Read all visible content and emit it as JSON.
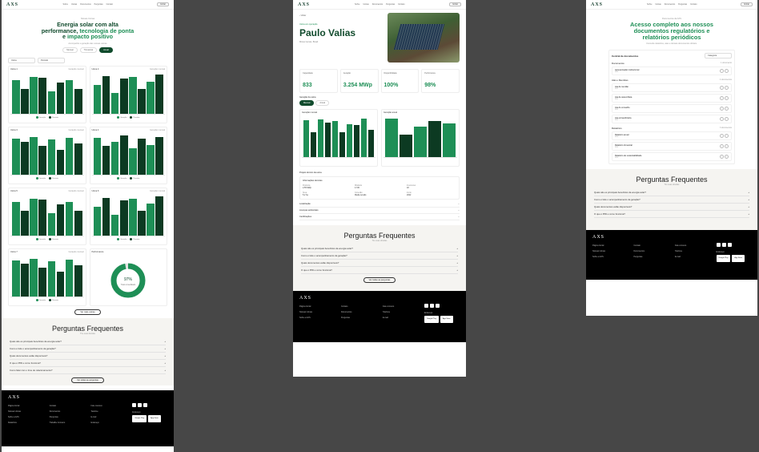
{
  "nav": {
    "logo": "AXS",
    "links": [
      "Sobre",
      "Usinas",
      "Documentos",
      "Perguntas",
      "Contato"
    ],
    "button": "Entrar"
  },
  "page1": {
    "kicker": "Nossas Usinas",
    "title_line1": "Energia solar com alta",
    "title_line2a": "performance, ",
    "title_line2b": "tecnologia de ponta",
    "title_line3a": "e ",
    "title_line3b": "impacto positivo",
    "subtitle": "Acompanhe a geração das nossas usinas",
    "pills": [
      "Mensal",
      "Trimestral",
      "Anual"
    ],
    "select_a": "Usina",
    "select_b": "Período",
    "cards": [
      {
        "name": "Usina 1",
        "info": "Geração mensal"
      },
      {
        "name": "Usina 2",
        "info": "Geração mensal"
      },
      {
        "name": "Usina 3",
        "info": "Geração mensal"
      },
      {
        "name": "Usina 4",
        "info": "Geração mensal"
      },
      {
        "name": "Usina 5",
        "info": "Geração mensal"
      },
      {
        "name": "Usina 6",
        "info": "Geração mensal"
      },
      {
        "name": "Usina 7",
        "info": "Geração mensal"
      }
    ],
    "legend": [
      "Geração",
      "Prevista"
    ],
    "donut": {
      "title": "Performance",
      "value": "97%",
      "label": "Total consolidado",
      "level": 0.97
    },
    "more_button": "Ver mais usinas"
  },
  "faq": {
    "title": "Perguntas Frequentes",
    "subtitle": "Tire suas dúvidas",
    "items": [
      "Quais são os principais benefícios da energia solar?",
      "Como é feito o acompanhamento da geração?",
      "Quais documentos estão disponíveis?",
      "O que é PPA e como funciona?",
      "Como falar com o time de relacionamento?"
    ],
    "button": "Ver todas as perguntas"
  },
  "footer": {
    "logo": "AXS",
    "cols": [
      [
        "Página Inicial",
        "Nossas Usinas",
        "Sobre a AXS",
        "Relatórios"
      ],
      [
        "Contato",
        "Documentos",
        "Perguntas",
        "Trabalhe Conosco"
      ],
      [
        "Fale conosco",
        "Telefone",
        "E-mail",
        "Endereço"
      ]
    ],
    "address_title": "Endereço",
    "stores": [
      "Google Play",
      "App Store"
    ]
  },
  "page2": {
    "back": "Voltar",
    "tag": "Usina em operação",
    "name": "Paulo Valias",
    "location": "Minas Gerais, Brasil",
    "stats": [
      {
        "label": "Capacidade",
        "value": "833"
      },
      {
        "label": "Geração",
        "value": "3.254 MWp"
      },
      {
        "label": "Disponibilidade",
        "value": "100%"
      },
      {
        "label": "Performance",
        "value": "98%"
      }
    ],
    "section": "Geração da usina",
    "tabs": [
      "Mensal",
      "Anual"
    ],
    "chart_a": "Geração mensal",
    "chart_b": "Geração anual",
    "details_title": "Projeto técnico da usina",
    "info_title": "Informações técnicas",
    "info": [
      {
        "k": "Potência",
        "v": "2,55 MWp"
      },
      {
        "k": "Módulos",
        "v": "4.720"
      },
      {
        "k": "Inversores",
        "v": "18"
      },
      {
        "k": "Área",
        "v": "5,2 ha"
      },
      {
        "k": "Conexão",
        "v": "Média tensão"
      },
      {
        "k": "Início",
        "v": "2022"
      }
    ],
    "accordions": [
      "Localização",
      "Licenças ambientais",
      "Certificações"
    ]
  },
  "page3": {
    "kicker": "Documentos da AXS",
    "title_a": "Acesso completo aos nossos",
    "title_b": "documentos regulatórios e",
    "title_c": "relatórios periódicos",
    "intro": "Consulte relatórios, atas e demais documentos oficiais.",
    "panel_title": "Central de documentos",
    "select": "Categoria",
    "sections": [
      {
        "title": "Documentos",
        "count": "1 documento",
        "rows": [
          "Apresentação institucional"
        ]
      },
      {
        "title": "Atas e Reuniões",
        "count": "4 documentos",
        "rows": [
          "Ata de reunião",
          "Ata de assembleia",
          "Ata do conselho",
          "Ata extraordinária"
        ]
      },
      {
        "title": "Relatórios",
        "count": "3 documentos",
        "rows": [
          "Relatório anual",
          "Relatório trimestral",
          "Relatório de sustentabilidade"
        ]
      }
    ],
    "row_meta": "PDF"
  }
}
